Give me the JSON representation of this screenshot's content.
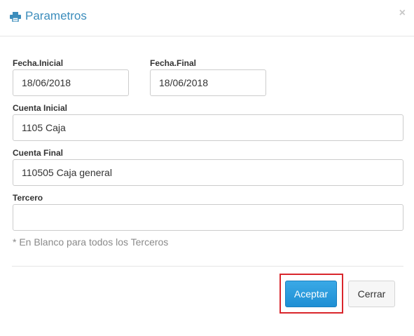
{
  "dialog": {
    "title": "Parametros",
    "close_symbol": "×",
    "title_icon": "printer-icon",
    "accent_color": "#3c8dbc"
  },
  "form": {
    "fecha_inicial": {
      "label": "Fecha.Inicial",
      "value": "18/06/2018"
    },
    "fecha_final": {
      "label": "Fecha.Final",
      "value": "18/06/2018"
    },
    "cuenta_inicial": {
      "label": "Cuenta Inicial",
      "value": "1105 Caja"
    },
    "cuenta_final": {
      "label": "Cuenta Final",
      "value": "110505 Caja general"
    },
    "tercero": {
      "label": "Tercero",
      "value": ""
    },
    "hint": "* En Blanco para todos los Terceros"
  },
  "actions": {
    "accept_label": "Aceptar",
    "close_label": "Cerrar",
    "highlight_color": "#d9262c"
  }
}
